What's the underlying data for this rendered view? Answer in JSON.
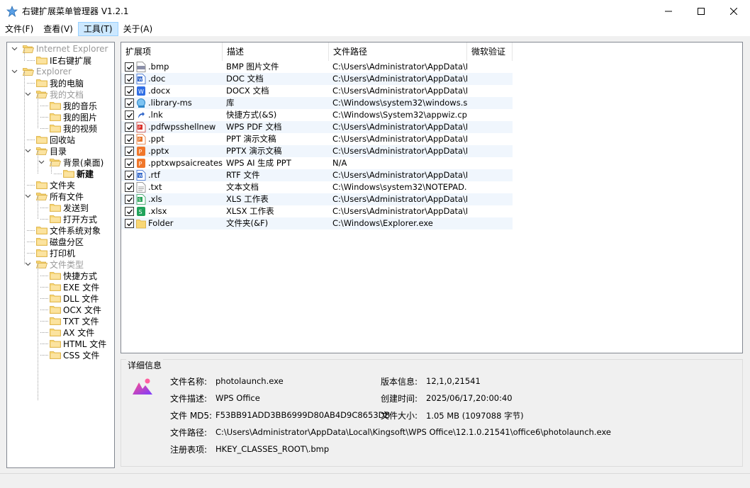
{
  "window": {
    "title": "右键扩展菜单管理器 V1.2.1"
  },
  "menu": [
    {
      "label": "文件(F)"
    },
    {
      "label": "查看(V)"
    },
    {
      "label": "工具(T)",
      "active": true
    },
    {
      "label": "关于(A)"
    }
  ],
  "tree": [
    {
      "label": "Internet Explorer",
      "level": 0,
      "expanded": true,
      "style": "gray"
    },
    {
      "label": "IE右键扩展",
      "level": 1
    },
    {
      "label": "Explorer",
      "level": 0,
      "expanded": true,
      "style": "gray"
    },
    {
      "label": "我的电脑",
      "level": 1
    },
    {
      "label": "我的文档",
      "level": 1,
      "expanded": true,
      "style": "gray"
    },
    {
      "label": "我的音乐",
      "level": 2
    },
    {
      "label": "我的图片",
      "level": 2
    },
    {
      "label": "我的视频",
      "level": 2
    },
    {
      "label": "回收站",
      "level": 1
    },
    {
      "label": "目录",
      "level": 1,
      "expanded": true
    },
    {
      "label": "背景(桌面)",
      "level": 2,
      "expanded": true
    },
    {
      "label": "新建",
      "level": 3,
      "style": "bold"
    },
    {
      "label": "文件夹",
      "level": 1
    },
    {
      "label": "所有文件",
      "level": 1,
      "expanded": true
    },
    {
      "label": "发送到",
      "level": 2
    },
    {
      "label": "打开方式",
      "level": 2
    },
    {
      "label": "文件系统对象",
      "level": 1
    },
    {
      "label": "磁盘分区",
      "level": 1
    },
    {
      "label": "打印机",
      "level": 1
    },
    {
      "label": "文件类型",
      "level": 1,
      "expanded": true,
      "style": "gray"
    },
    {
      "label": "快捷方式",
      "level": 2
    },
    {
      "label": "EXE 文件",
      "level": 2
    },
    {
      "label": "DLL 文件",
      "level": 2
    },
    {
      "label": "OCX 文件",
      "level": 2
    },
    {
      "label": "TXT 文件",
      "level": 2
    },
    {
      "label": "AX 文件",
      "level": 2
    },
    {
      "label": "HTML 文件",
      "level": 2
    },
    {
      "label": "CSS 文件",
      "level": 2
    }
  ],
  "list": {
    "columns": [
      "扩展项",
      "描述",
      "文件路径",
      "微软验证"
    ],
    "rows": [
      {
        "ext": ".bmp",
        "desc": "BMP 图片文件",
        "path": "C:\\Users\\Administrator\\AppData\\L...",
        "verified": "",
        "icon": "bmp"
      },
      {
        "ext": ".doc",
        "desc": "DOC 文档",
        "path": "C:\\Users\\Administrator\\AppData\\L...",
        "verified": "",
        "icon": "word"
      },
      {
        "ext": ".docx",
        "desc": "DOCX 文档",
        "path": "C:\\Users\\Administrator\\AppData\\L...",
        "verified": "",
        "icon": "word-blue"
      },
      {
        "ext": ".library-ms",
        "desc": "库",
        "path": "C:\\Windows\\system32\\windows.st...",
        "verified": "",
        "icon": "library"
      },
      {
        "ext": ".lnk",
        "desc": "快捷方式(&S)",
        "path": "C:\\Windows\\System32\\appwiz.cpl",
        "verified": "",
        "icon": "shortcut"
      },
      {
        "ext": ".pdfwpsshellnew",
        "desc": "WPS PDF 文档",
        "path": "C:\\Users\\Administrator\\AppData\\L...",
        "verified": "",
        "icon": "pdf"
      },
      {
        "ext": ".ppt",
        "desc": "PPT 演示文稿",
        "path": "C:\\Users\\Administrator\\AppData\\L...",
        "verified": "",
        "icon": "ppt"
      },
      {
        "ext": ".pptx",
        "desc": "PPTX 演示文稿",
        "path": "C:\\Users\\Administrator\\AppData\\L...",
        "verified": "",
        "icon": "ppt-orange"
      },
      {
        "ext": ".pptxwpsaicreates...",
        "desc": "WPS AI 生成 PPT",
        "path": "N/A",
        "verified": "",
        "icon": "ppt-orange"
      },
      {
        "ext": ".rtf",
        "desc": "RTF 文件",
        "path": "C:\\Users\\Administrator\\AppData\\L...",
        "verified": "",
        "icon": "word"
      },
      {
        "ext": ".txt",
        "desc": "文本文档",
        "path": "C:\\Windows\\system32\\NOTEPAD....",
        "verified": "",
        "icon": "txt"
      },
      {
        "ext": ".xls",
        "desc": "XLS 工作表",
        "path": "C:\\Users\\Administrator\\AppData\\L...",
        "verified": "",
        "icon": "xls"
      },
      {
        "ext": ".xlsx",
        "desc": "XLSX 工作表",
        "path": "C:\\Users\\Administrator\\AppData\\L...",
        "verified": "",
        "icon": "xls-green"
      },
      {
        "ext": "Folder",
        "desc": "文件夹(&F)",
        "path": "C:\\Windows\\Explorer.exe",
        "verified": "",
        "icon": "folder"
      }
    ]
  },
  "details": {
    "legend": "详细信息",
    "name_label": "文件名称:",
    "name": "photolaunch.exe",
    "desc_label": "文件描述:",
    "desc": "WPS Office",
    "md5_label": "文件 MD5:",
    "md5": "F53BB91ADD3BB6999D80AB4D9C8653DB",
    "path_label": "文件路径:",
    "path": "C:\\Users\\Administrator\\AppData\\Local\\Kingsoft\\WPS Office\\12.1.0.21541\\office6\\photolaunch.exe",
    "reg_label": "注册表项:",
    "reg": "HKEY_CLASSES_ROOT\\.bmp",
    "version_label": "版本信息:",
    "version": "12,1,0,21541",
    "created_label": "创建时间:",
    "created": "2025/06/17,20:00:40",
    "size_label": "文件大小:",
    "size": "1.05 MB (1097088 字节)"
  },
  "colors": {
    "accent": "#0078d7",
    "folder": "#f8d775",
    "folder_edge": "#d6a93a"
  }
}
